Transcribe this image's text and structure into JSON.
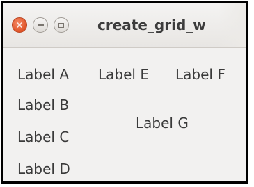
{
  "window": {
    "title": "create_grid_w",
    "buttons": {
      "close": "close-icon",
      "minimize": "minimize-icon",
      "maximize": "maximize-icon"
    }
  },
  "labels": {
    "a": "Label A",
    "b": "Label B",
    "c": "Label C",
    "d": "Label D",
    "e": "Label E",
    "f": "Label F",
    "g": "Label G"
  },
  "colors": {
    "close_button": "#e05428",
    "window_background": "#f2f1f0",
    "text": "#3a3a3a"
  }
}
